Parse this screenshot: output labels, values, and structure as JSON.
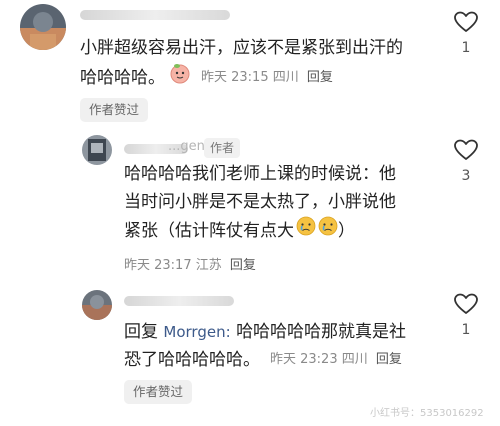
{
  "comments": [
    {
      "body": "小胖超级容易出汗，应该不是紧张到出汗的",
      "body_line2": "哈哈哈哈。",
      "time": "昨天 23:15 四川",
      "reply": "回复",
      "likes": "1",
      "author_liked": "作者赞过"
    },
    {
      "name_partial": "...gen",
      "author_tag": "作者",
      "body_lines": [
        "哈哈哈哈我们老师上课的时候说：他",
        "当时问小胖是不是太热了，小胖说他",
        "紧张（估计阵仗有点大"
      ],
      "body_end": "）",
      "time": "昨天 23:17 江苏",
      "reply": "回复",
      "likes": "3"
    },
    {
      "reply_prefix": "回复",
      "reply_target": "Morrgen:",
      "body_after": "哈哈哈哈哈那就真是社",
      "body_line2": "恐了哈哈哈哈哈。",
      "time": "昨天 23:23 四川",
      "reply": "回复",
      "likes": "1",
      "author_liked": "作者赞过"
    }
  ],
  "watermark": "小红书号：5353016292",
  "icons": [
    "heart-outline-icon",
    "peach-sticker-icon",
    "crying-emoji-icon"
  ],
  "colors": {
    "text": "#222222",
    "meta": "#8a8a8a",
    "chip_bg": "#f0f0f0",
    "heart": "#333333"
  }
}
